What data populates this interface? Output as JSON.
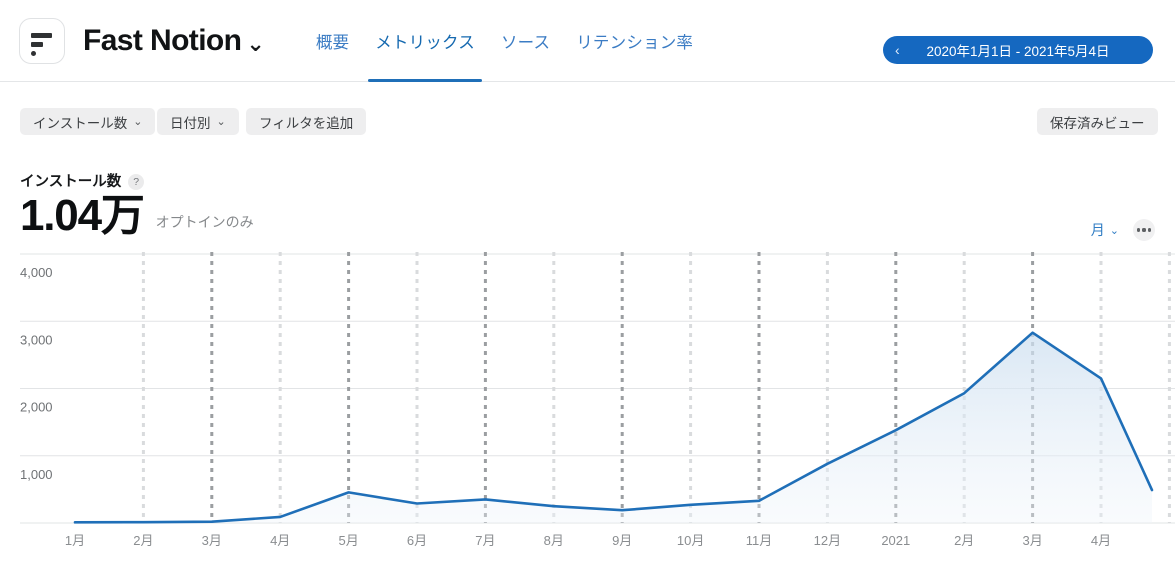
{
  "header": {
    "logo_icon": "fast-notion-logo-icon",
    "app_title": "Fast Notion",
    "title_caret": "⌄",
    "tabs": [
      {
        "label": "概要",
        "active": false
      },
      {
        "label": "メトリックス",
        "active": true
      },
      {
        "label": "ソース",
        "active": false
      },
      {
        "label": "リテンション率",
        "active": false
      }
    ],
    "date_range": {
      "prev_icon": "chevron-left-icon",
      "prev_glyph": "‹",
      "label": "2020年1月1日 - 2021年5月4日"
    }
  },
  "filter_bar": {
    "metric_chip": {
      "label": "インストール数",
      "caret": "⌄"
    },
    "breakdown_chip": {
      "label": "日付別",
      "caret": "⌄"
    },
    "add_filter_chip": {
      "label": "フィルタを追加"
    },
    "saved_view_chip": {
      "label": "保存済みビュー"
    }
  },
  "metric_summary": {
    "label": "インストール数",
    "help_glyph": "?",
    "value": "1.04万",
    "note": "オプトインのみ"
  },
  "chart_controls": {
    "granularity": {
      "label": "月",
      "caret": "⌄"
    },
    "more_options_icon": "more-horizontal-icon"
  },
  "colors": {
    "accent_blue": "#1568c0",
    "line_blue": "#1f6fb8",
    "tab_blue": "#3b7cc4",
    "chip_gray": "#eeeeef",
    "gridline": "#e2e4e6",
    "vgrid_dark": "#9b9ea1",
    "vgrid_light": "#d9dbdd"
  },
  "chart_data": {
    "type": "area",
    "title": "インストール数",
    "xlabel": "",
    "ylabel": "",
    "grid": true,
    "legend": "none",
    "ylim": [
      0,
      4000
    ],
    "yticks": [
      1000,
      2000,
      3000,
      4000
    ],
    "ytick_labels": [
      "1,000",
      "2,000",
      "3,000",
      "4,000"
    ],
    "categories": [
      "1月",
      "2月",
      "3月",
      "4月",
      "5月",
      "6月",
      "7月",
      "8月",
      "9月",
      "10月",
      "11月",
      "12月",
      "2021",
      "2月",
      "3月",
      "4月"
    ],
    "series": [
      {
        "name": "インストール数",
        "values": [
          10,
          12,
          20,
          90,
          455,
          290,
          350,
          250,
          190,
          270,
          330,
          880,
          1380,
          1930,
          2830,
          2150
        ]
      }
    ],
    "trailing_value": 490,
    "trailing_note": "partial period after 4月"
  }
}
